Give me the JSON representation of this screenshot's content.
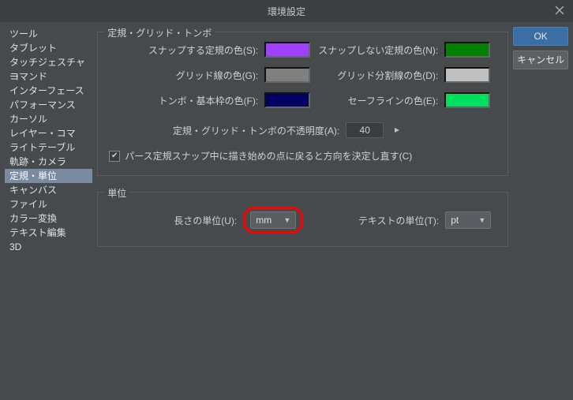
{
  "window": {
    "title": "環境設定"
  },
  "buttons": {
    "ok": "OK",
    "cancel": "キャンセル"
  },
  "sidebar": {
    "items": [
      "ツール",
      "タブレット",
      "タッチジェスチャー",
      "コマンド",
      "インターフェース",
      "パフォーマンス",
      "カーソル",
      "レイヤー・コマ",
      "ライトテーブル",
      "軌跡・カメラ",
      "定規・単位",
      "キャンバス",
      "ファイル",
      "カラー変換",
      "テキスト編集",
      "3D"
    ],
    "selected_index": 10
  },
  "groups": {
    "ruler": {
      "title": "定規・グリッド・トンボ",
      "snap_color_label": "スナップする定規の色(S):",
      "nosnap_color_label": "スナップしない定規の色(N):",
      "grid_line_label": "グリッド線の色(G):",
      "grid_div_label": "グリッド分割線の色(D):",
      "tombo_label": "トンボ・基本枠の色(F):",
      "safeline_label": "セーフラインの色(E):",
      "opacity_label": "定規・グリッド・トンボの不透明度(A):",
      "opacity_value": "40",
      "checkbox_label": "パース定規スナップ中に描き始めの点に戻ると方向を決定し直す(C)",
      "checkbox_checked": true
    },
    "units": {
      "title": "単位",
      "length_label": "長さの単位(U):",
      "length_value": "mm",
      "text_label": "テキストの単位(T):",
      "text_value": "pt"
    }
  }
}
